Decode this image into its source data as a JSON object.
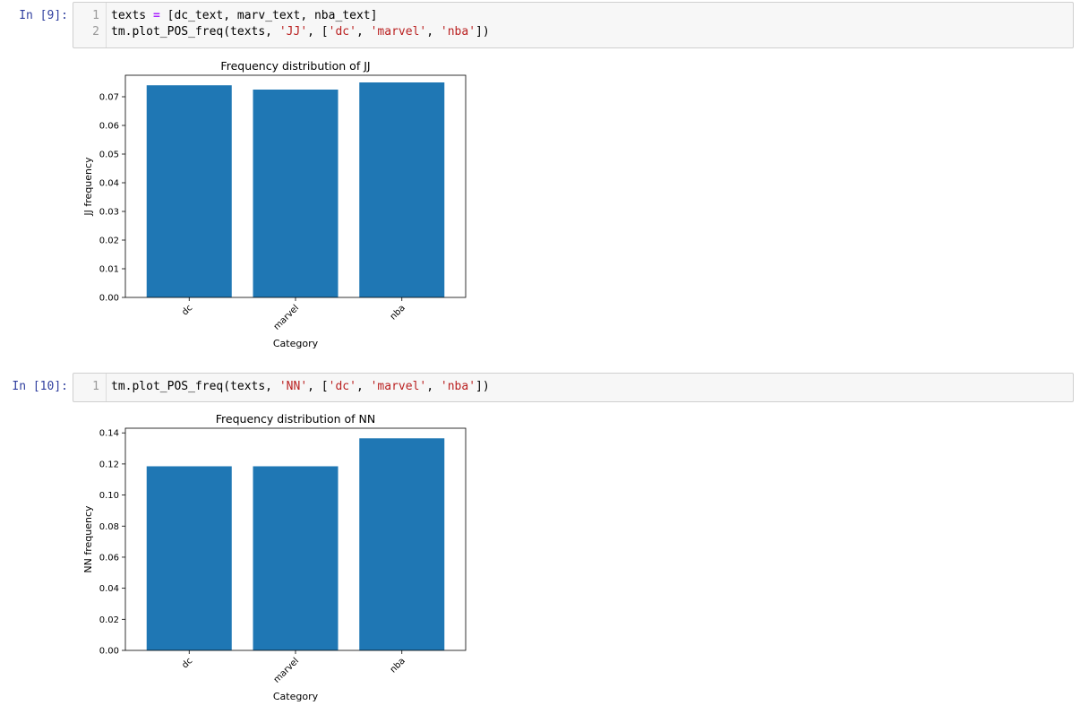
{
  "cells": [
    {
      "prompt": "In [9]:",
      "code": [
        [
          {
            "t": "texts ",
            "c": ""
          },
          {
            "t": "=",
            "c": "op"
          },
          {
            "t": " [dc_text, marv_text, nba_text]",
            "c": ""
          }
        ],
        [
          {
            "t": "tm.plot_POS_freq(texts, ",
            "c": ""
          },
          {
            "t": "'JJ'",
            "c": "str"
          },
          {
            "t": ", [",
            "c": ""
          },
          {
            "t": "'dc'",
            "c": "str"
          },
          {
            "t": ", ",
            "c": ""
          },
          {
            "t": "'marvel'",
            "c": "str"
          },
          {
            "t": ", ",
            "c": ""
          },
          {
            "t": "'nba'",
            "c": "str"
          },
          {
            "t": "])",
            "c": ""
          }
        ]
      ]
    },
    {
      "prompt": "In [10]:",
      "code": [
        [
          {
            "t": "tm.plot_POS_freq(texts, ",
            "c": ""
          },
          {
            "t": "'NN'",
            "c": "str"
          },
          {
            "t": ", [",
            "c": ""
          },
          {
            "t": "'dc'",
            "c": "str"
          },
          {
            "t": ", ",
            "c": ""
          },
          {
            "t": "'marvel'",
            "c": "str"
          },
          {
            "t": ", ",
            "c": ""
          },
          {
            "t": "'nba'",
            "c": "str"
          },
          {
            "t": "])",
            "c": ""
          }
        ]
      ]
    }
  ],
  "chart_data": [
    {
      "type": "bar",
      "title": "Frequency distribution of JJ",
      "xlabel": "Category",
      "ylabel": "JJ frequency",
      "categories": [
        "dc",
        "marvel",
        "nba"
      ],
      "values": [
        0.074,
        0.0725,
        0.075
      ],
      "ylim": [
        0,
        0.0775
      ],
      "yticks": [
        "0.00",
        "0.01",
        "0.02",
        "0.03",
        "0.04",
        "0.05",
        "0.06",
        "0.07"
      ],
      "ytick_values": [
        0,
        0.01,
        0.02,
        0.03,
        0.04,
        0.05,
        0.06,
        0.07
      ],
      "bar_color": "#1f77b4",
      "grid": false
    },
    {
      "type": "bar",
      "title": "Frequency distribution of NN",
      "xlabel": "Category",
      "ylabel": "NN frequency",
      "categories": [
        "dc",
        "marvel",
        "nba"
      ],
      "values": [
        0.1185,
        0.1185,
        0.1365
      ],
      "ylim": [
        0,
        0.143
      ],
      "yticks": [
        "0.00",
        "0.02",
        "0.04",
        "0.06",
        "0.08",
        "0.10",
        "0.12",
        "0.14"
      ],
      "ytick_values": [
        0,
        0.02,
        0.04,
        0.06,
        0.08,
        0.1,
        0.12,
        0.14
      ],
      "bar_color": "#1f77b4",
      "grid": false
    }
  ]
}
